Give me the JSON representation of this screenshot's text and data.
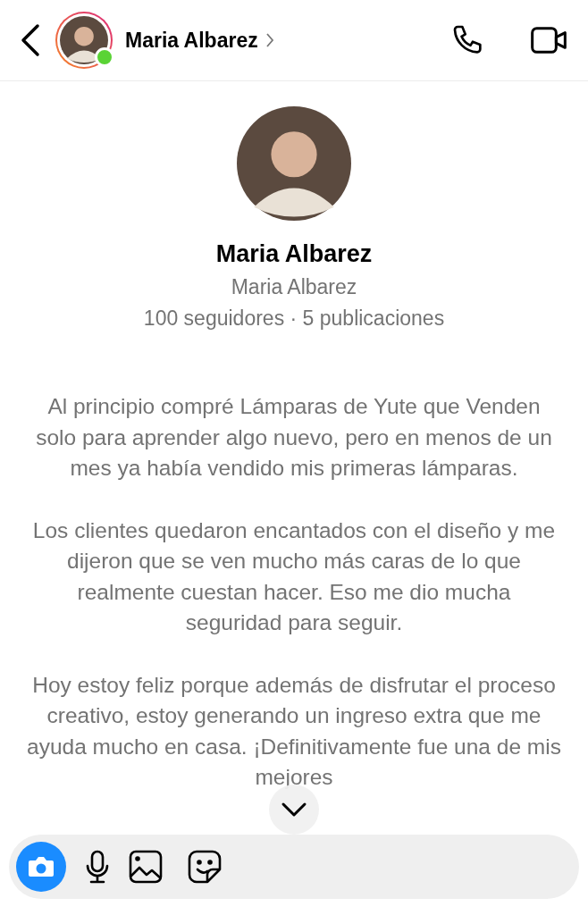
{
  "header": {
    "name": "Maria Albarez",
    "online": true
  },
  "profile": {
    "name": "Maria Albarez",
    "username": "Maria Albarez",
    "stats": "100 seguidores · 5 publicaciones"
  },
  "message": {
    "paragraphs": [
      "Al principio compré Lámparas de Yute que Venden solo para aprender algo nuevo, pero en menos de un mes ya había vendido mis primeras lámparas.",
      "Los clientes quedaron encantados con el diseño y me dijeron que se ven mucho más caras de lo que realmente cuestan hacer. Eso me dio mucha seguridad para seguir.",
      "Hoy estoy feliz porque además de disfrutar el proceso creativo, estoy generando un ingreso extra que me ayuda mucho en casa. ¡Definitivamente fue una de mis mejores"
    ]
  }
}
